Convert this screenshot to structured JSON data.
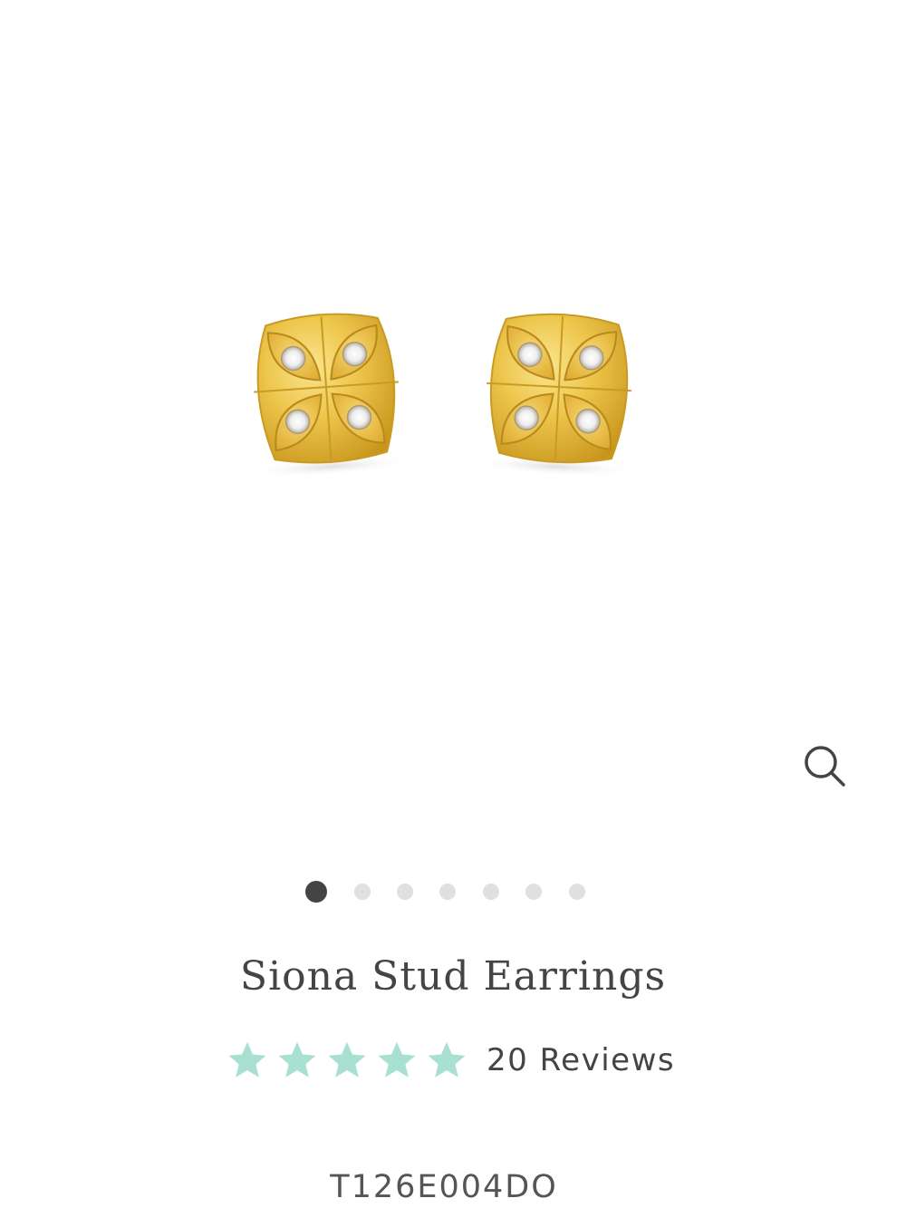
{
  "product": {
    "title": "Siona Stud Earrings",
    "image_alt": "earrings-product-photo",
    "rating": 5,
    "max_rating": 5,
    "reviews_label": "20 Reviews",
    "sku": "T126E004DO"
  },
  "gallery": {
    "slide_count": 7,
    "active_slide": 1,
    "zoom_icon": "magnifier-icon"
  },
  "colors": {
    "star": "#a8e0d2",
    "gold": "#e6bd3e",
    "dot_active": "#444444",
    "dot_inactive": "#e0e0e0",
    "text": "#444444"
  }
}
